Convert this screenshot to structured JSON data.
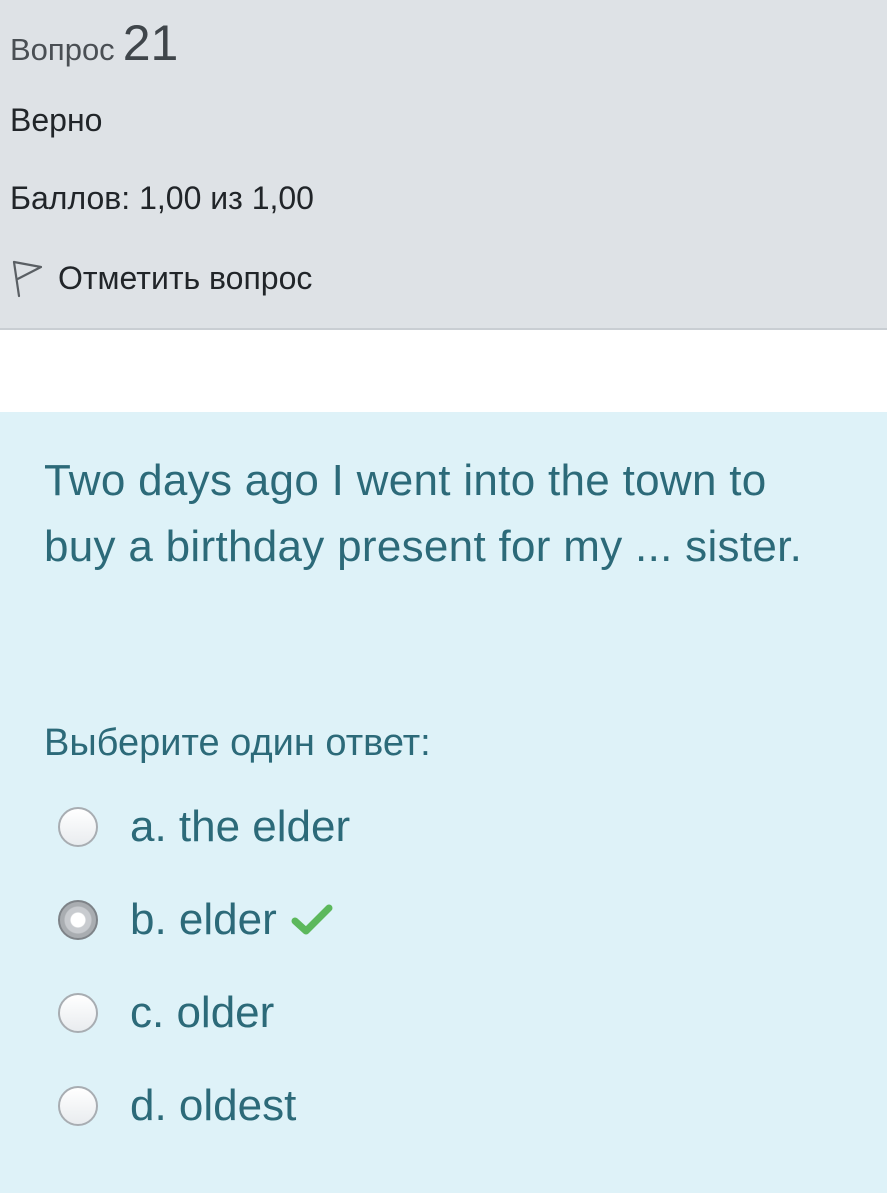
{
  "info": {
    "question_label": "Вопрос",
    "question_number": "21",
    "status": "Верно",
    "grade": "Баллов: 1,00 из 1,00",
    "flag_label": "Отметить вопрос",
    "flag_icon": "flag-icon"
  },
  "question": {
    "text": "Two days ago I went into the town to buy a birthday present for my ... sister.",
    "prompt": "Выберите один ответ:",
    "answers": [
      {
        "label": "a. the elder",
        "selected": false
      },
      {
        "label": "b. elder",
        "selected": true,
        "correct_icon": "check-icon"
      },
      {
        "label": "c. older",
        "selected": false
      },
      {
        "label": "d. oldest",
        "selected": false
      }
    ]
  },
  "colors": {
    "info_background": "#dee2e6",
    "content_background": "#def2f8",
    "text_accent": "#2c6a79",
    "correct_check": "#5cb85c"
  }
}
